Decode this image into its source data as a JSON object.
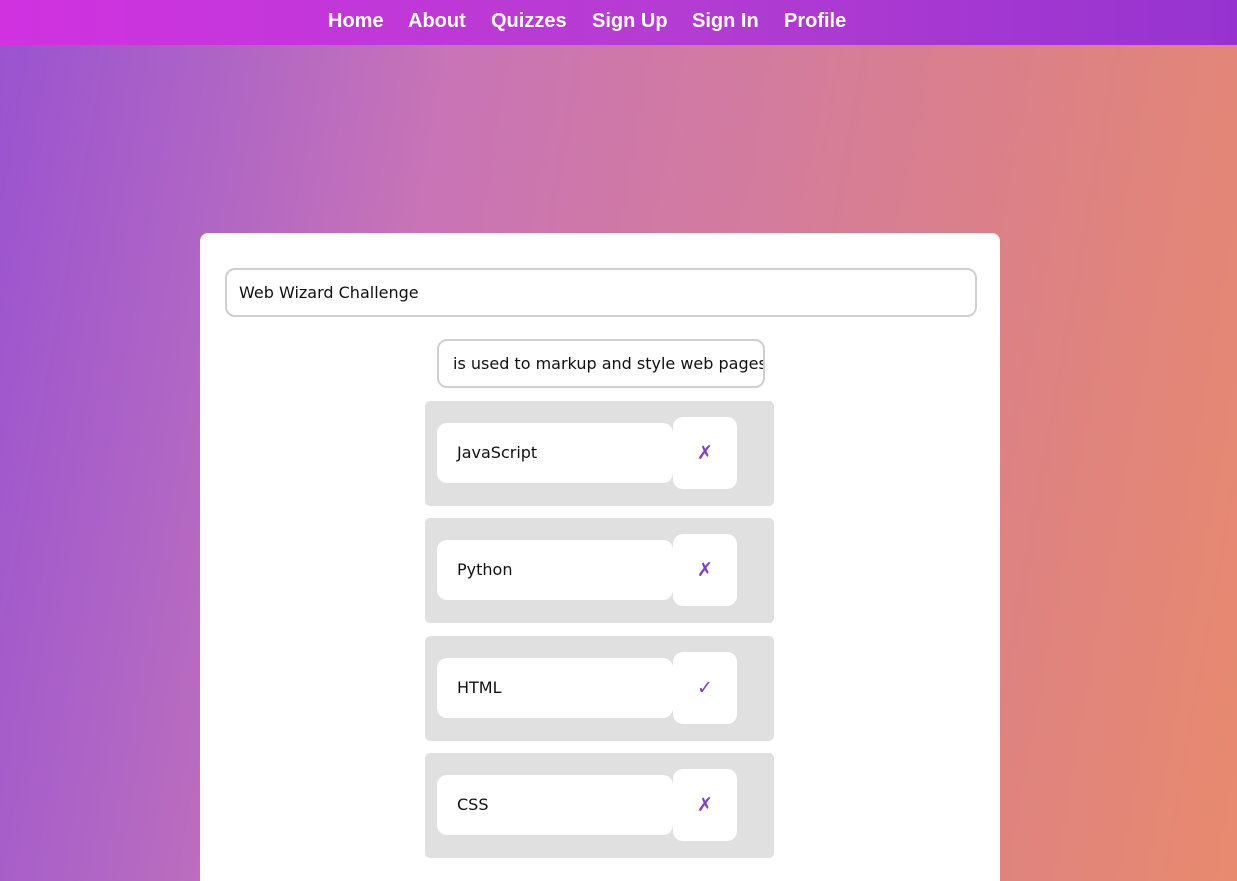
{
  "nav": {
    "items": [
      {
        "label": "Home"
      },
      {
        "label": "About"
      },
      {
        "label": "Quizzes"
      },
      {
        "label": "Sign Up"
      },
      {
        "label": "Sign In"
      },
      {
        "label": "Profile"
      }
    ]
  },
  "quiz": {
    "title_value": "Web Wizard Challenge",
    "question_value": "is used to markup and style web pages?",
    "answers": [
      {
        "text": "JavaScript",
        "mark": "✗",
        "mark_icon": "cross-icon",
        "correct": false
      },
      {
        "text": "Python",
        "mark": "✗",
        "mark_icon": "cross-icon",
        "correct": false
      },
      {
        "text": "HTML",
        "mark": "✓",
        "mark_icon": "check-icon",
        "correct": true
      },
      {
        "text": "CSS",
        "mark": "✗",
        "mark_icon": "cross-icon",
        "correct": false
      }
    ]
  },
  "colors": {
    "nav_gradient_start": "#d032e0",
    "nav_gradient_end": "#9633d0",
    "page_gradient_start": "#9a52d0",
    "page_gradient_end": "#e88a6e",
    "mark_color": "#7b3fd6",
    "answer_row_bg": "#e0e0e0"
  }
}
